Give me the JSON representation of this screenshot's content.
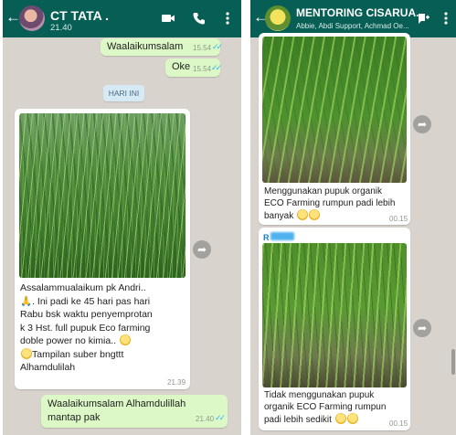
{
  "left_chat": {
    "header": {
      "title": "CT TATA .",
      "subtitle": "21.40",
      "icons": [
        "back-arrow-icon",
        "avatar",
        "video-call-icon",
        "phone-call-icon",
        "menu-dots-icon"
      ]
    },
    "messages_top": [
      {
        "text": "Waalaikumsalam",
        "time": "15.54",
        "status": "read"
      },
      {
        "text": "Oke",
        "time": "15.54",
        "status": "read"
      }
    ],
    "date_chip": "HARI INI",
    "image_message": {
      "lines": [
        "Assalammualaikum pk Andri..",
        ". Ini padi ke 45 hari pas hari",
        "Rabu bsk waktu penyemprotan",
        "k 3 Hst. full pupuk Eco farming",
        "doble power no kimia..",
        "Tampilan suber bngttt",
        "Alhamdulilah"
      ],
      "time": "21.39"
    },
    "reply": {
      "lines": [
        "Waalaikumsalam Alhamdulillah",
        "mantap pak"
      ],
      "time": "21.40",
      "status": "read"
    }
  },
  "right_chat": {
    "header": {
      "title": "MENTORING CISARUA...",
      "subtitle": "Abbie, Abdi Support, Achmad Oe...",
      "icons": [
        "back-arrow-icon",
        "group-avatar",
        "add-participant-icon",
        "menu-dots-icon"
      ]
    },
    "message_1": {
      "lines": [
        "Menggunakan pupuk organik",
        "ECO Farming rumpun padi lebih",
        "banyak"
      ],
      "time": "00.15"
    },
    "message_2": {
      "sender": "R",
      "lines": [
        "Tidak menggunakan pupuk",
        "organik ECO Farming rumpun",
        "padi lebih sedikit"
      ],
      "time": "00.15"
    }
  },
  "colors": {
    "header": "#075e54",
    "chat_bg": "#d8d3cc",
    "outgoing": "#dcf8c6",
    "read_ticks": "#34b7f1"
  }
}
